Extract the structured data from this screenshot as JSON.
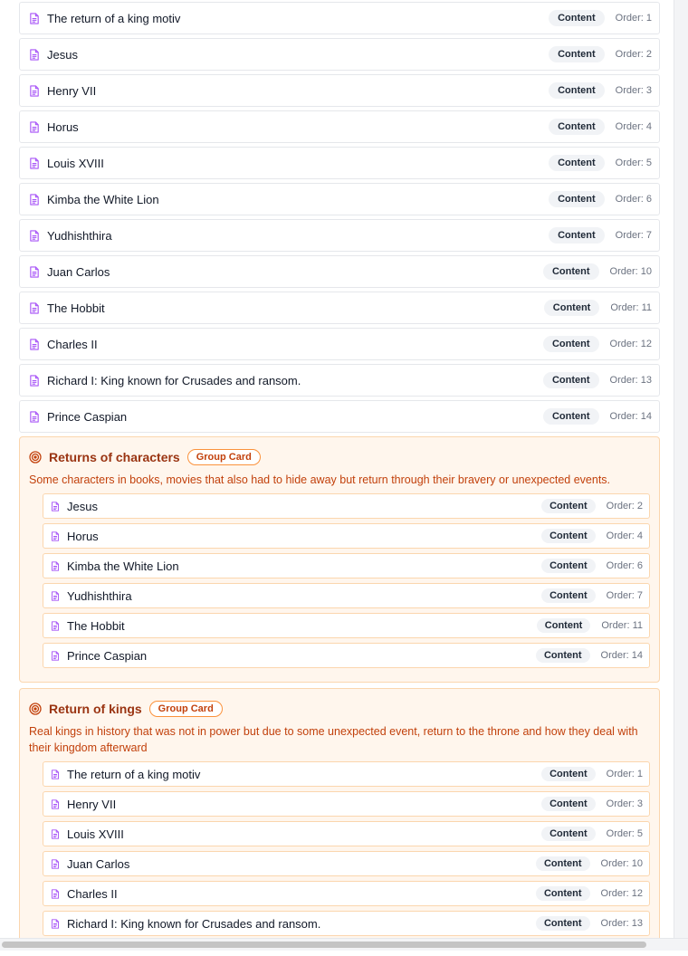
{
  "colors": {
    "doc_icon": "#a855f7",
    "group_bg": "#fff6ed",
    "group_border": "#fbd6ae",
    "group_title": "#9a3412",
    "group_desc": "#c2410c",
    "group_badge": "#c2410c",
    "badge_bg": "#f1f3f6"
  },
  "icons": {
    "item": "document-icon",
    "group": "target-icon"
  },
  "items": [
    {
      "title": "The return of a king motiv",
      "badge": "Content",
      "order": "Order: 1"
    },
    {
      "title": "Jesus",
      "badge": "Content",
      "order": "Order: 2"
    },
    {
      "title": "Henry VII",
      "badge": "Content",
      "order": "Order: 3"
    },
    {
      "title": "Horus",
      "badge": "Content",
      "order": "Order: 4"
    },
    {
      "title": "Louis XVIII",
      "badge": "Content",
      "order": "Order: 5"
    },
    {
      "title": "Kimba the White Lion",
      "badge": "Content",
      "order": "Order: 6"
    },
    {
      "title": "Yudhishthira",
      "badge": "Content",
      "order": "Order: 7"
    },
    {
      "title": "Juan Carlos",
      "badge": "Content",
      "order": "Order: 10"
    },
    {
      "title": "The Hobbit",
      "badge": "Content",
      "order": "Order: 11"
    },
    {
      "title": "Charles II",
      "badge": "Content",
      "order": "Order: 12"
    },
    {
      "title": "Richard I: King known for Crusades and ransom.",
      "badge": "Content",
      "order": "Order: 13"
    },
    {
      "title": "Prince Caspian",
      "badge": "Content",
      "order": "Order: 14"
    }
  ],
  "groups": [
    {
      "title": "Returns of characters",
      "badge": "Group Card",
      "description": "Some characters in books, movies that also had to hide away but return through their bravery or unexpected events.",
      "items": [
        {
          "title": "Jesus",
          "badge": "Content",
          "order": "Order: 2"
        },
        {
          "title": "Horus",
          "badge": "Content",
          "order": "Order: 4"
        },
        {
          "title": "Kimba the White Lion",
          "badge": "Content",
          "order": "Order: 6"
        },
        {
          "title": "Yudhishthira",
          "badge": "Content",
          "order": "Order: 7"
        },
        {
          "title": "The Hobbit",
          "badge": "Content",
          "order": "Order: 11"
        },
        {
          "title": "Prince Caspian",
          "badge": "Content",
          "order": "Order: 14"
        }
      ]
    },
    {
      "title": "Return of kings",
      "badge": "Group Card",
      "description": "Real kings in history that was not in power but due to some unexpected event, return to the throne and how they deal with their kingdom afterward",
      "items": [
        {
          "title": "The return of a king motiv",
          "badge": "Content",
          "order": "Order: 1"
        },
        {
          "title": "Henry VII",
          "badge": "Content",
          "order": "Order: 3"
        },
        {
          "title": "Louis XVIII",
          "badge": "Content",
          "order": "Order: 5"
        },
        {
          "title": "Juan Carlos",
          "badge": "Content",
          "order": "Order: 10"
        },
        {
          "title": "Charles II",
          "badge": "Content",
          "order": "Order: 12"
        },
        {
          "title": "Richard I: King known for Crusades and ransom.",
          "badge": "Content",
          "order": "Order: 13"
        }
      ]
    }
  ]
}
